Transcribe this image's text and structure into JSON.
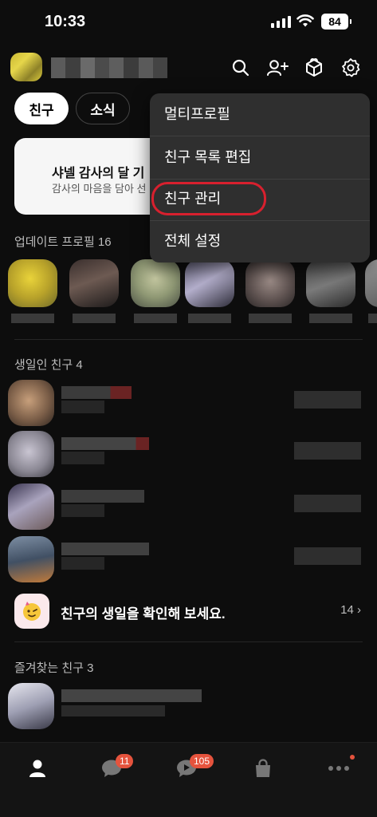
{
  "status_bar": {
    "time": "10:33",
    "battery": "84"
  },
  "tabs": [
    {
      "label": "친구",
      "active": true
    },
    {
      "label": "소식",
      "active": false
    }
  ],
  "banner": {
    "title": "샤넬 감사의 달 기",
    "subtitle": "감사의 마음을 담아 선"
  },
  "sections": {
    "updated_profiles": "업데이트 프로필 16",
    "birthday_friends": "생일인 친구 4",
    "favorite_friends": "즐겨찾는 친구 3"
  },
  "birthday_cta": {
    "text": "친구의 생일을 확인해 보세요.",
    "count": "14"
  },
  "menu": {
    "items": [
      "멀티프로필",
      "친구 목록 편집",
      "친구 관리",
      "전체 설정"
    ],
    "highlighted": "친구 관리"
  },
  "bottom_nav": {
    "chats_badge": "11",
    "openchat_badge": "105"
  },
  "colors": {
    "background": "#0d0d0d",
    "menu_bg": "#2f2f2f",
    "badge": "#e5533d",
    "highlight_ring": "#d8202e"
  },
  "icons": [
    "search-icon",
    "add-friend-icon",
    "gift-icon",
    "settings-icon",
    "person-icon",
    "chat-icon",
    "openchat-icon",
    "shopping-icon",
    "more-icon",
    "cake-icon"
  ]
}
